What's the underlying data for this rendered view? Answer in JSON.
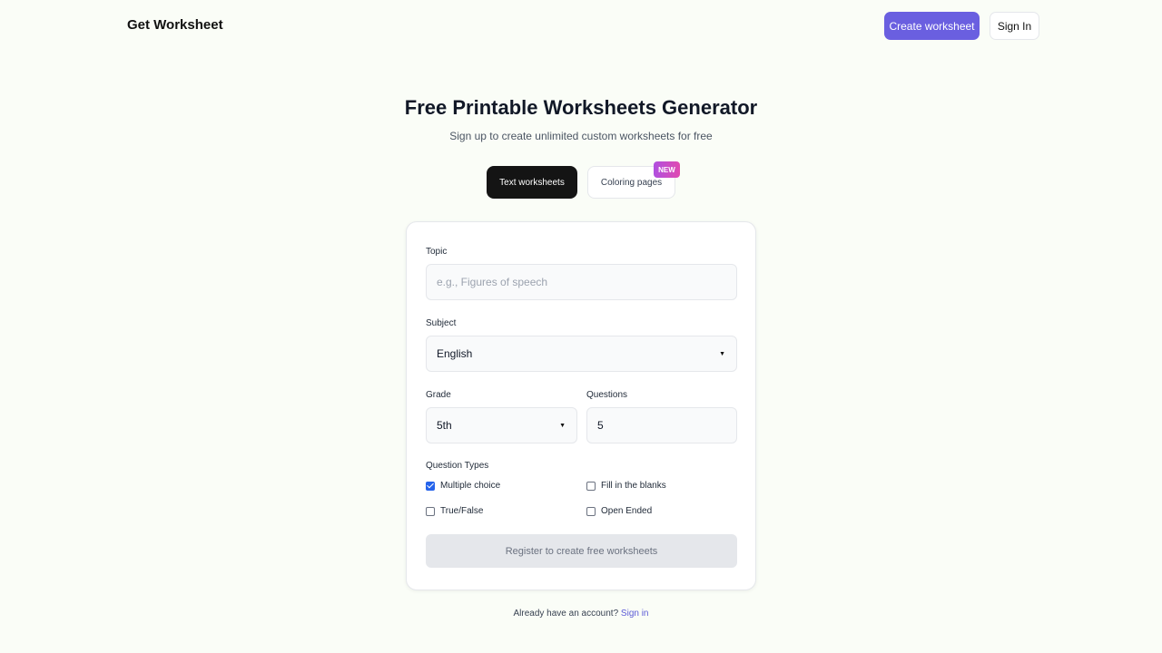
{
  "header": {
    "brand": "Get Worksheet",
    "create_label": "Create worksheet",
    "signin_label": "Sign In"
  },
  "hero": {
    "title": "Free Printable Worksheets Generator",
    "subtitle": "Sign up to create unlimited custom worksheets for free"
  },
  "tabs": [
    {
      "label": "Text worksheets",
      "active": true
    },
    {
      "label": "Coloring pages",
      "active": false,
      "badge": "NEW"
    }
  ],
  "form": {
    "topic_label": "Topic",
    "topic_placeholder": "e.g., Figures of speech",
    "subject_label": "Subject",
    "subject_value": "English",
    "grade_label": "Grade",
    "grade_value": "5th",
    "questions_label": "Questions",
    "questions_value": "5",
    "question_types_label": "Question Types",
    "question_types": [
      {
        "label": "Multiple choice",
        "checked": true
      },
      {
        "label": "Fill in the blanks",
        "checked": false
      },
      {
        "label": "True/False",
        "checked": false
      },
      {
        "label": "Open Ended",
        "checked": false
      }
    ],
    "register_label": "Register to create free worksheets"
  },
  "footer": {
    "text": "Already have an account?",
    "link": "Sign in"
  },
  "colors": {
    "accent": "#6a5fe0",
    "checkbox": "#2563eb",
    "dark_tab": "#141414"
  }
}
